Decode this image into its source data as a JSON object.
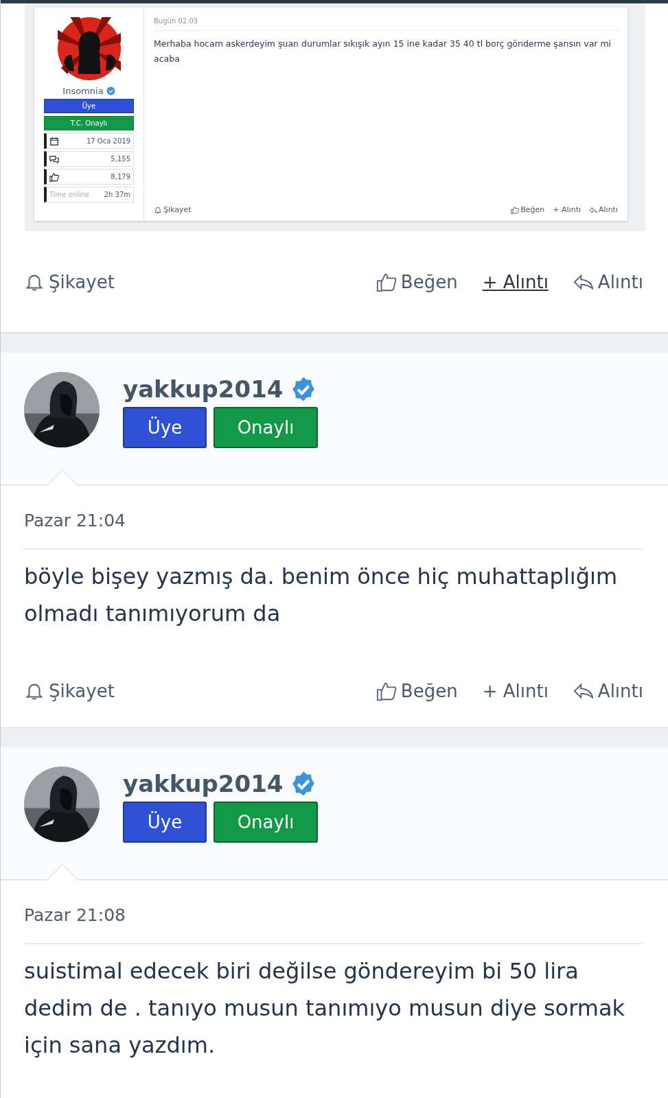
{
  "quoted_screenshot": {
    "author": {
      "name": "Insomnia",
      "verified": true,
      "badges": [
        {
          "label": "Üye",
          "kind": "member"
        },
        {
          "label": "T.C. Onaylı",
          "kind": "verified"
        }
      ]
    },
    "stats": [
      {
        "kind": "calendar",
        "value": "17 Oca 2019"
      },
      {
        "kind": "messages",
        "value": "5,155"
      },
      {
        "kind": "likes",
        "value": "8,179"
      },
      {
        "kind": "online",
        "label": "Time online",
        "value": "2h 37m"
      }
    ],
    "date": "Bugün 02:03",
    "message": "Merhaba hocam askerdeyim şuan durumlar sıkışık ayın 15 ine kadar 35 40 tl borç gönderme şansın var mi acaba",
    "report": "Şikayet",
    "actions": [
      {
        "kind": "like",
        "label": "Beğen"
      },
      {
        "kind": "quote",
        "label": "+ Alıntı"
      },
      {
        "kind": "reply",
        "label": "Alıntı"
      }
    ]
  },
  "first_post_footer": {
    "report": "Şikayet",
    "actions": [
      {
        "kind": "like",
        "label": "Beğen",
        "underlined": false
      },
      {
        "kind": "quote",
        "label": "+ Alıntı",
        "underlined": true
      },
      {
        "kind": "reply",
        "label": "Alıntı",
        "underlined": false
      }
    ]
  },
  "posts": [
    {
      "author": "yakkup2014",
      "verified": true,
      "badges": [
        {
          "label": "Üye",
          "kind": "member"
        },
        {
          "label": "Onaylı",
          "kind": "verified"
        }
      ],
      "date": "Pazar 21:04",
      "message": "böyle bişey yazmış da. benim önce hiç muhattaplığım olmadı tanımıyorum da",
      "report": "Şikayet",
      "actions": [
        {
          "kind": "like",
          "label": "Beğen",
          "underlined": false
        },
        {
          "kind": "quote",
          "label": "+ Alıntı",
          "underlined": false
        },
        {
          "kind": "reply",
          "label": "Alıntı",
          "underlined": false
        }
      ]
    },
    {
      "author": "yakkup2014",
      "verified": true,
      "badges": [
        {
          "label": "Üye",
          "kind": "member"
        },
        {
          "label": "Onaylı",
          "kind": "verified"
        }
      ],
      "date": "Pazar 21:08",
      "message": "suistimal edecek biri değilse göndereyim bi 50 lira dedim de . tanıyo musun tanımıyo musun diye sormak için sana yazdım."
    }
  ]
}
